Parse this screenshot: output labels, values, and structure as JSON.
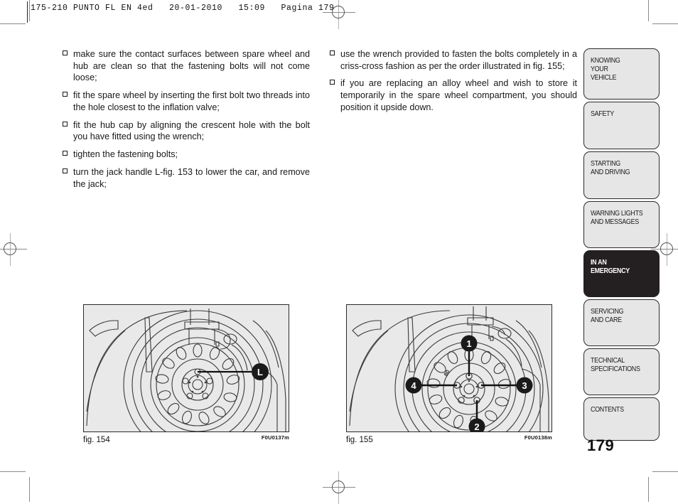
{
  "print_header": "175-210 PUNTO FL EN 4ed   20-01-2010   15:09   Pagina 179",
  "page_number": "179",
  "body": {
    "left_column": [
      "make sure the contact surfaces between spare wheel and hub are clean so that the fastening bolts will not come loose;",
      "fit the spare wheel by inserting the first bolt two threads into the hole closest to the inflation valve;",
      "fit the hub cap by aligning the crescent hole with the bolt you have fitted using the wrench;",
      "tighten the fastening bolts;",
      "turn the jack handle L-fig. 153 to lower the car, and remove the jack;"
    ],
    "right_column": [
      "use the wrench provided to fasten the bolts completely in a criss-cross fashion as per the order illustrated in fig. 155;",
      "if you are replacing an alloy wheel and wish to store it temporarily in the spare wheel compartment, you should position it upside down."
    ]
  },
  "figures": [
    {
      "caption": "fig. 154",
      "code": "F0U0137m",
      "callouts": [
        "L"
      ]
    },
    {
      "caption": "fig. 155",
      "code": "F0U0138m",
      "callouts": [
        "1",
        "2",
        "3",
        "4"
      ],
      "hub_marking": "80"
    }
  ],
  "tabs": [
    {
      "label": "KNOWING\nYOUR\nVEHICLE",
      "active": false,
      "height": 72
    },
    {
      "label": "SAFETY",
      "active": false,
      "height": 67
    },
    {
      "label": "STARTING\nAND DRIVING",
      "active": false,
      "height": 67
    },
    {
      "label": "WARNING LIGHTS\nAND MESSAGES",
      "active": false,
      "height": 66
    },
    {
      "label": "IN AN\nEMERGENCY",
      "active": true,
      "height": 66
    },
    {
      "label": "SERVICING\nAND CARE",
      "active": false,
      "height": 66
    },
    {
      "label": "TECHNICAL\nSPECIFICATIONS",
      "active": false,
      "height": 66
    },
    {
      "label": "CONTENTS",
      "active": false,
      "height": 61
    }
  ],
  "colors": {
    "active_tab_bg": "#241f20",
    "tab_bg": "#e6e6e6",
    "figure_bg": "#e9e9e9",
    "ink": "#1a1a1a"
  }
}
